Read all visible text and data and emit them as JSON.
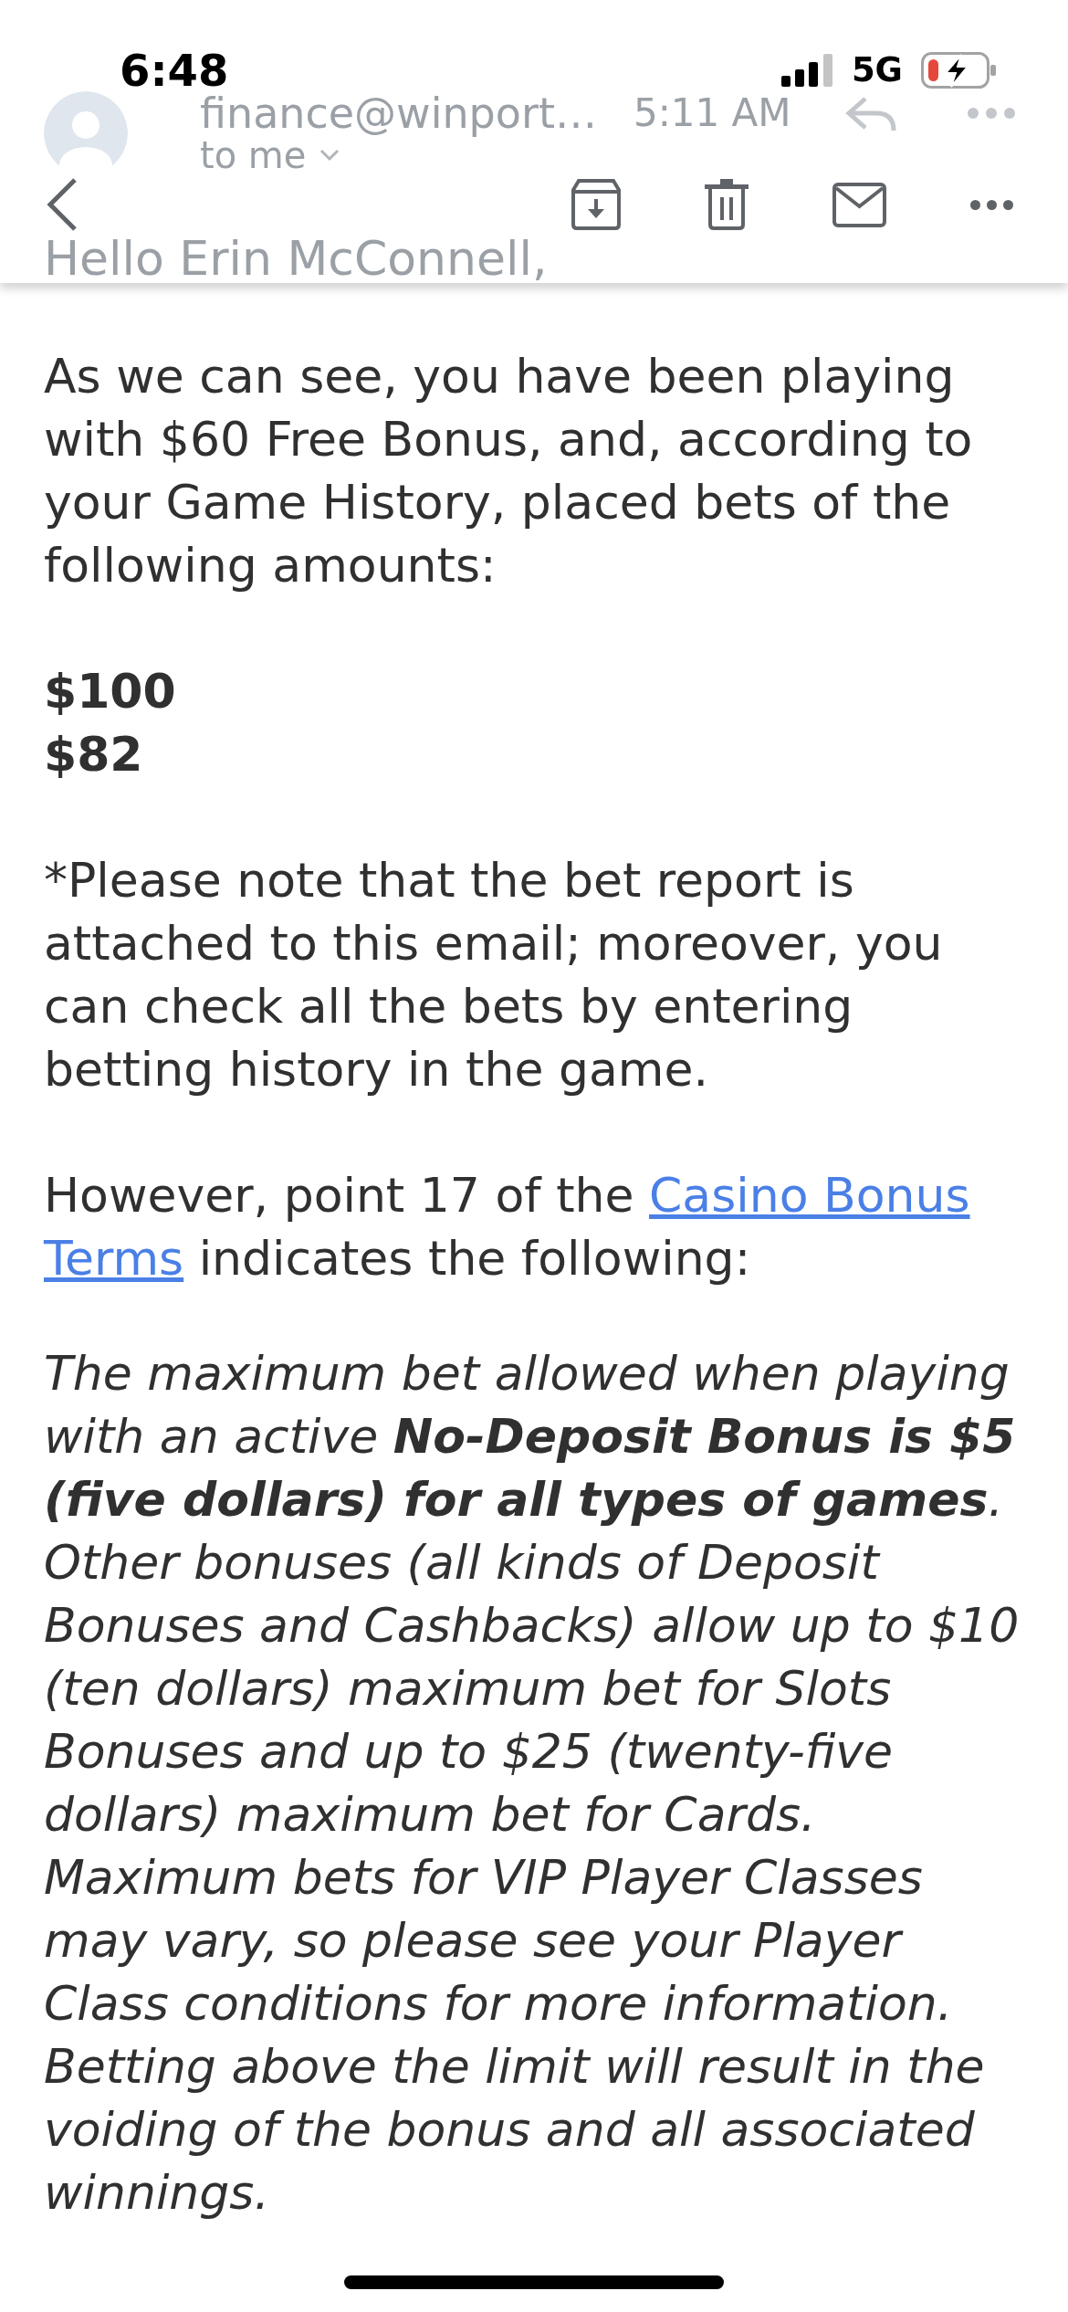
{
  "status_bar": {
    "time": "6:48",
    "network": "5G"
  },
  "message": {
    "sender": "finance@winport…",
    "time": "5:11 AM",
    "recipient": "to me",
    "greeting": "Hello Erin McConnell,"
  },
  "body": [
    {
      "kind": "plain",
      "lines": [
        "As we can see, you have been playing",
        "with $60 Free Bonus, and, according to",
        "your Game History, placed bets of the",
        "following amounts:"
      ]
    },
    {
      "kind": "amounts",
      "items": [
        "$100",
        "$82"
      ]
    },
    {
      "kind": "plain",
      "lines": [
        "*Please note that the bet report is",
        "attached to this email; moreover, you",
        "can check all the bets by entering",
        "betting history in the game."
      ]
    },
    {
      "kind": "linked",
      "lines": [
        [
          {
            "kind": "text",
            "text": "However, point 17 of the "
          },
          {
            "kind": "link",
            "text": "Casino Bonus"
          }
        ],
        [
          {
            "kind": "link",
            "text": "Terms"
          },
          {
            "kind": "text",
            "text": " indicates the following:"
          }
        ]
      ]
    },
    {
      "kind": "italic",
      "lines": [
        "The maximum bet allowed when playing",
        "with an active **No-Deposit Bonus is $5**",
        "**(five dollars) for all types of games**.",
        "Other bonuses (all kinds of Deposit",
        "Bonuses and Cashbacks) allow up to $10",
        "(ten dollars) maximum bet for Slots",
        "Bonuses and up to $25 (twenty-five",
        "dollars) maximum bet for Cards.",
        "Maximum bets for VIP Player Classes",
        "may vary, so please see your Player",
        "Class conditions for more information.",
        "Betting above the limit will result in the",
        "voiding of the bonus and all associated",
        "winnings."
      ]
    }
  ]
}
